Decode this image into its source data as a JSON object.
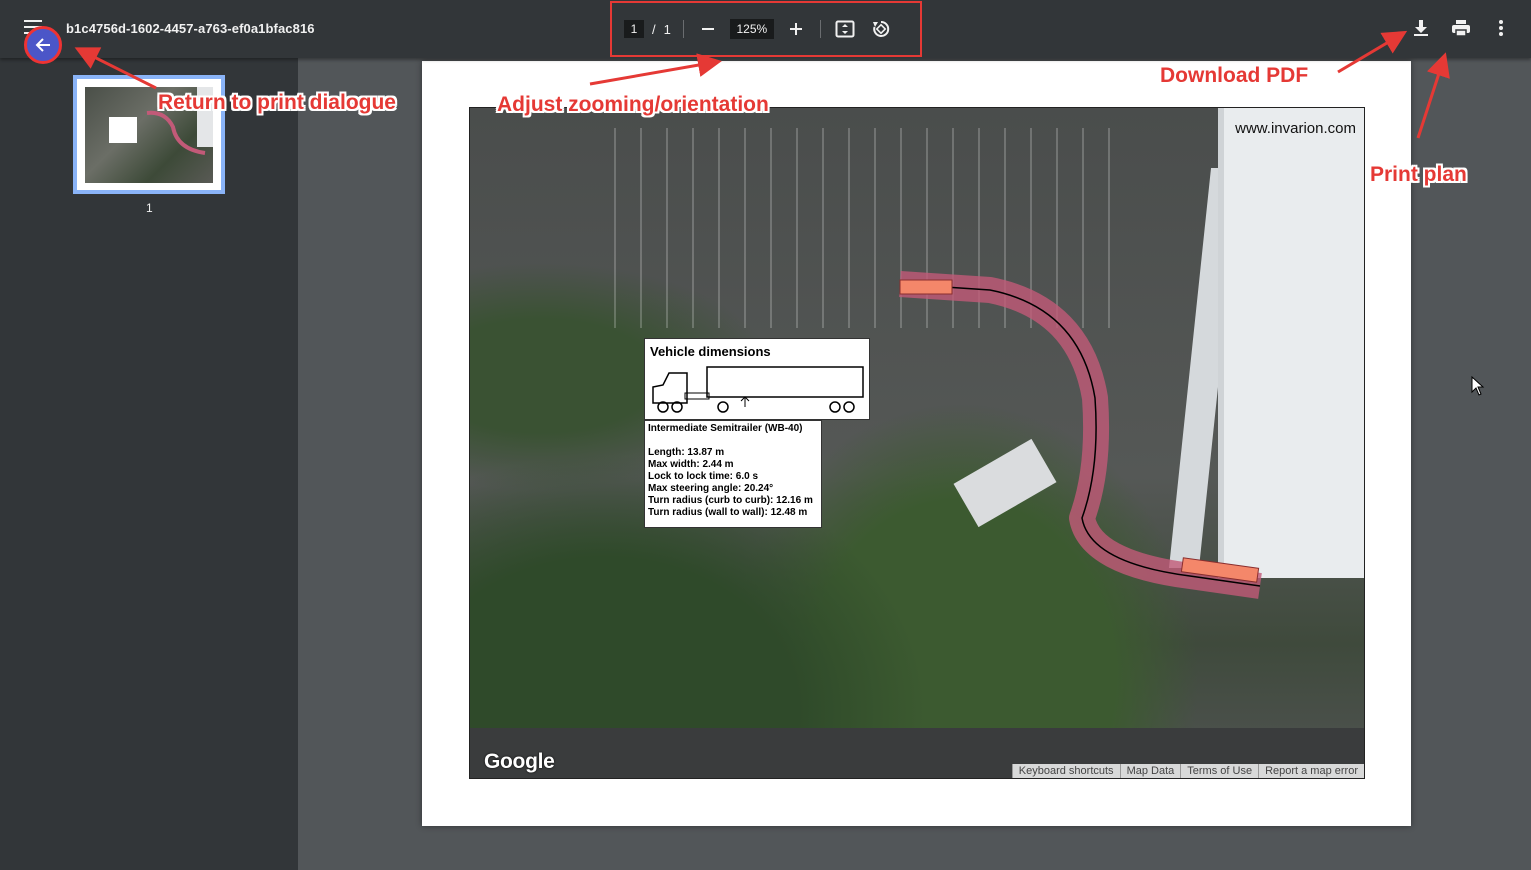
{
  "toolbar": {
    "doc_title": "b1c4756d-1602-4457-a763-ef0a1bfac816",
    "page_current": "1",
    "page_sep": "/",
    "page_total": "1",
    "zoom": "125%",
    "icons": [
      "menu-icon",
      "minus-icon",
      "plus-icon",
      "fit-page-icon",
      "rotate-icon",
      "download-icon",
      "print-icon",
      "more-icon",
      "back-arrow-icon"
    ]
  },
  "sidebar": {
    "thumbnails": [
      {
        "page_number": "1"
      }
    ]
  },
  "document": {
    "watermark": "www.invarion.com",
    "map_logo": "Google",
    "map_attribution": [
      "Keyboard shortcuts",
      "Map Data",
      "Terms of Use",
      "Report a map error"
    ],
    "vehicle_box": {
      "title": "Vehicle dimensions",
      "name": "Intermediate Semitrailer (WB-40)",
      "specs": [
        "Length: 13.87 m",
        "Max width: 2.44 m",
        "Lock to lock time: 6.0 s",
        "Max steering angle: 20.24°",
        "Turn radius (curb to curb): 12.16 m",
        "Turn radius (wall to wall): 12.48 m"
      ]
    }
  },
  "annotations": {
    "back": "Return to print dialogue",
    "zoom": "Adjust zooming/orientation",
    "download": "Download PDF",
    "print": "Print plan"
  },
  "colors": {
    "toolbar_bg": "#323639",
    "viewer_bg": "#525659",
    "annotation": "#e53935",
    "route_fill": "#c25a78",
    "thumbnail_border": "#8ab4f8"
  }
}
